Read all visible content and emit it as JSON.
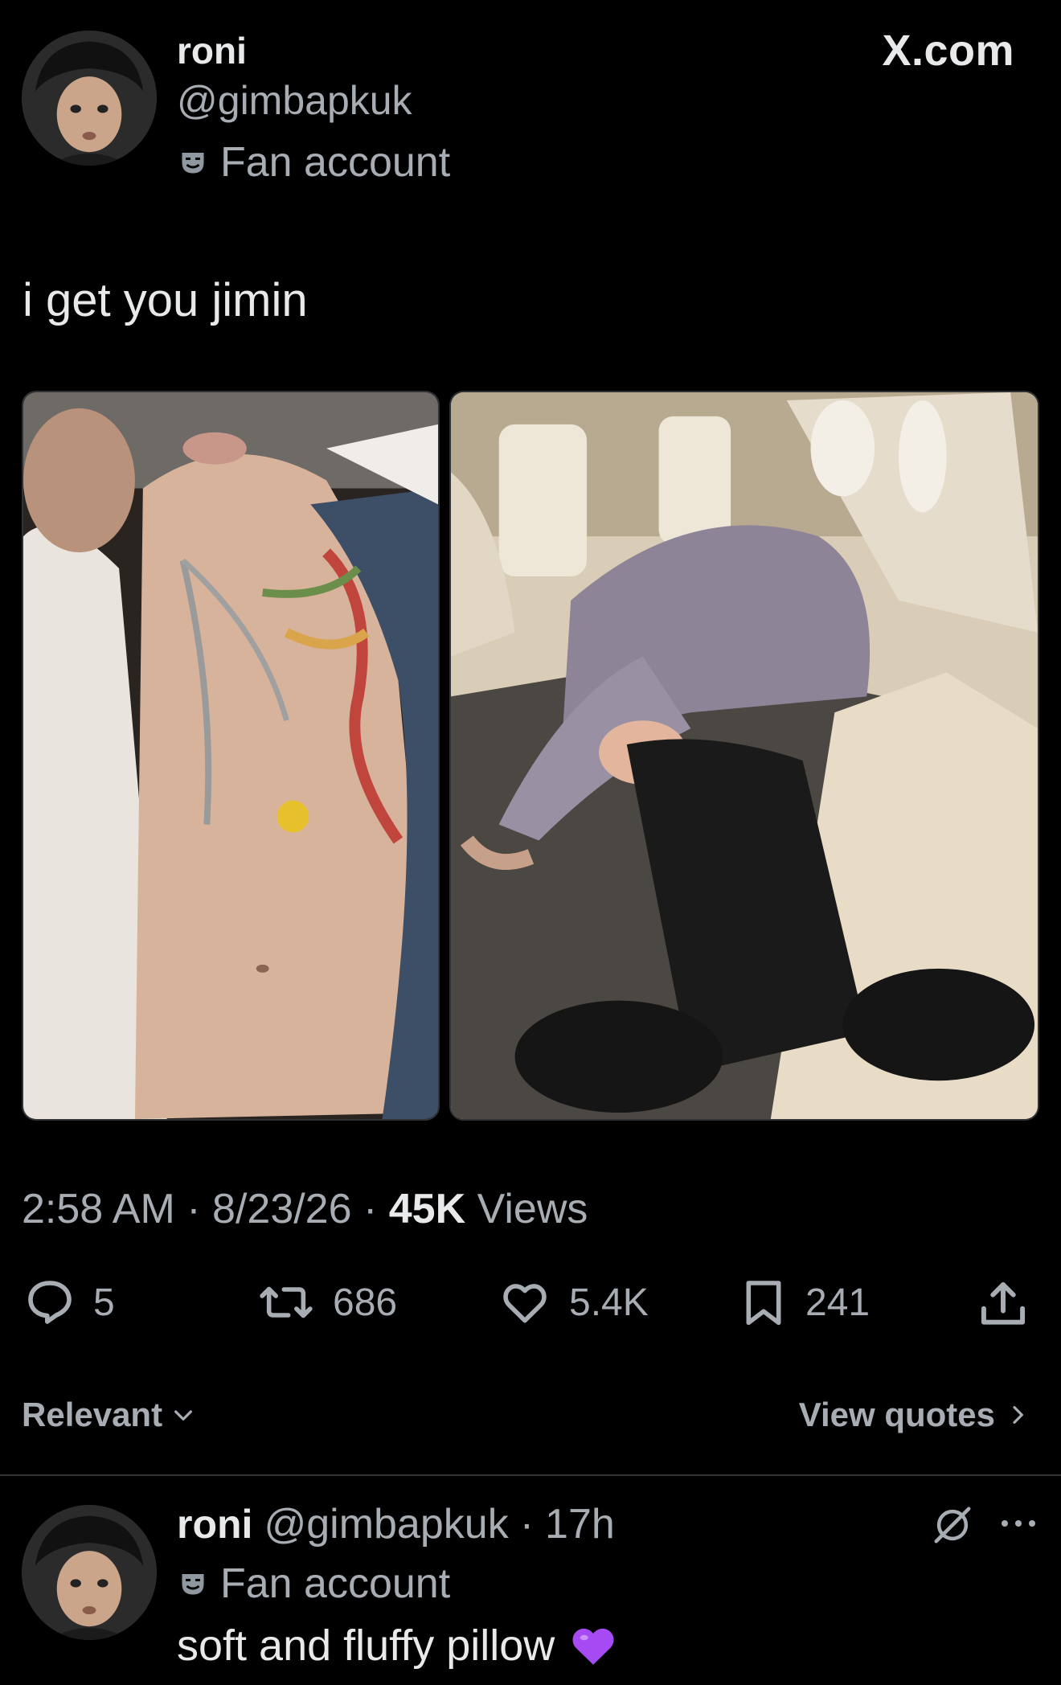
{
  "post": {
    "display_name": "roni",
    "handle": "@gimbapkuk",
    "badge_label": "Fan account",
    "source_label": "X.com",
    "text": "i get you jimin",
    "media": [
      {
        "icon": "photo-closeup-tattoo"
      },
      {
        "icon": "photo-airplane-cabin"
      }
    ],
    "time": "2:58 AM",
    "date": "8/23/26",
    "separator": "·",
    "views_count": "45K",
    "views_label": "Views"
  },
  "actions": {
    "replies": "5",
    "reposts": "686",
    "likes": "5.4K",
    "bookmarks": "241"
  },
  "filters": {
    "sort_label": "Relevant",
    "quotes_label": "View quotes"
  },
  "reply": {
    "display_name": "roni",
    "handle": "@gimbapkuk",
    "separator": "·",
    "time": "17h",
    "badge_label": "Fan account",
    "text": "soft and fluffy pillow",
    "emoji": "💜"
  },
  "colors": {
    "background": "#000000",
    "primary_text": "#e7e9ea",
    "secondary_text": "#a7adb2",
    "divider": "#2f3336"
  }
}
